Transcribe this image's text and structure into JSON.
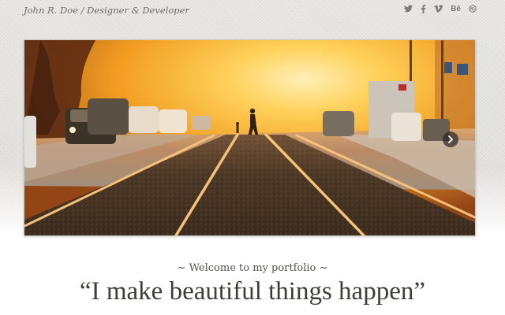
{
  "header": {
    "site_title": "John R. Doe / Designer & Developer",
    "social": [
      {
        "name": "twitter-icon"
      },
      {
        "name": "facebook-icon"
      },
      {
        "name": "vimeo-icon"
      },
      {
        "name": "behance-icon",
        "label": "Bē"
      },
      {
        "name": "dribbble-icon"
      }
    ]
  },
  "slider": {
    "image": "sunset-street-tram-rails-photo",
    "next_icon": "chevron-right-icon",
    "colors": {
      "sky": "#f7b52a",
      "glow": "#ffe9a0",
      "asphalt": "#3a2c22",
      "rail": "#f4b76a"
    }
  },
  "intro": {
    "welcome": "~ Welcome to my portfolio ~",
    "tagline": "“I make beautiful things happen”"
  }
}
